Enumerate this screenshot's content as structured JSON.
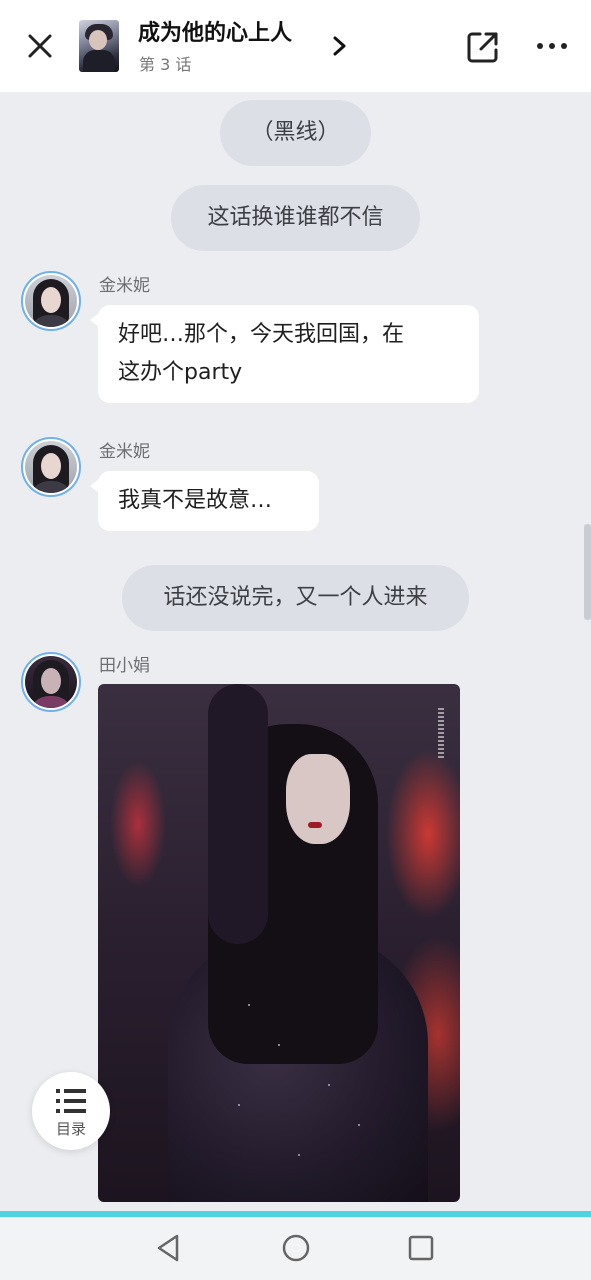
{
  "header": {
    "title": "成为他的心上人",
    "subtitle": "第 3 话",
    "close_icon": "close-icon",
    "share_icon": "share-icon",
    "more_icon": "more-icon"
  },
  "messages": [
    {
      "type": "narration",
      "text": "（黑线）"
    },
    {
      "type": "narration",
      "text": "这话换谁谁都不信"
    },
    {
      "type": "bubble",
      "name": "金米妮",
      "lines": [
        "好吧…那个，今天我回国，在",
        "这办个party"
      ]
    },
    {
      "type": "bubble",
      "name": "金米妮",
      "lines": [
        "我真不是故意…"
      ]
    },
    {
      "type": "narration",
      "text": "话还没说完，又一个人进来"
    },
    {
      "type": "image",
      "name": "田小娟"
    }
  ],
  "toc": {
    "label": "目录"
  },
  "reading_progress": 1.0,
  "colors": {
    "background": "#ebedf1",
    "narration_bg": "#dcdfe6",
    "bubble_bg": "#ffffff",
    "avatar_ring": "#6fb1e8",
    "progress": "#4fd3df"
  }
}
